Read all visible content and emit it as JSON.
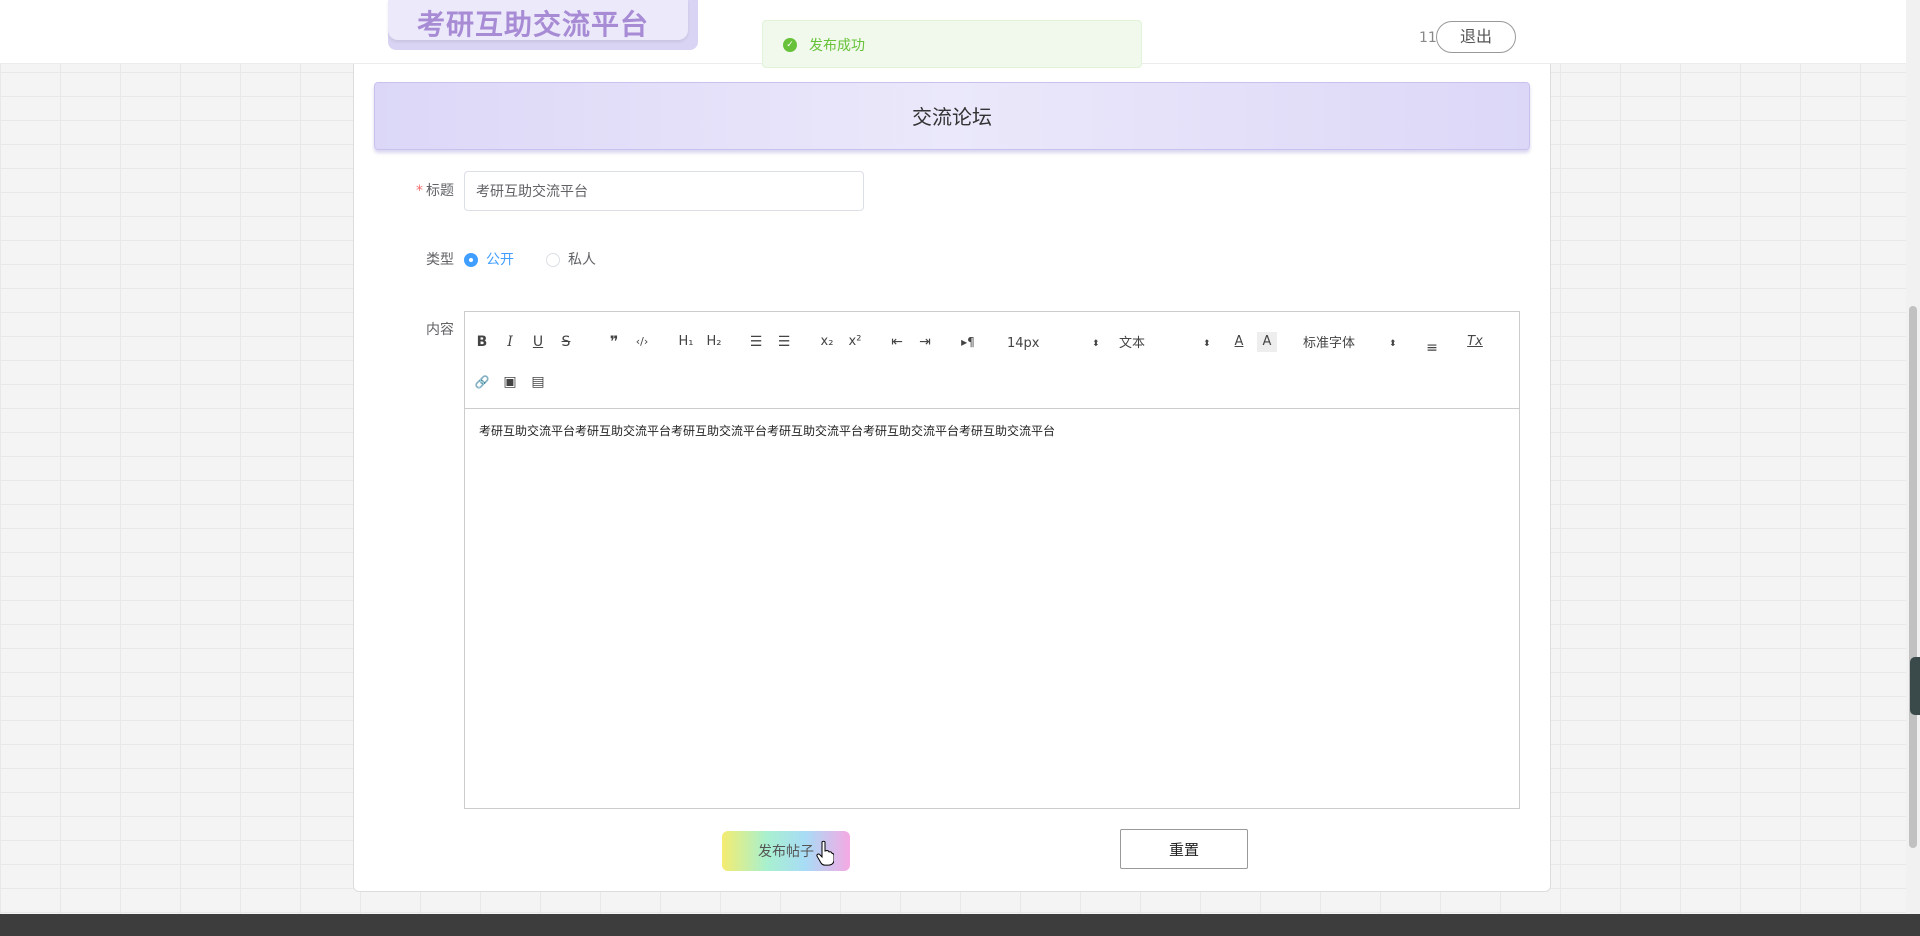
{
  "header": {
    "logo_text": "考研互助交流平台",
    "user_number": "11",
    "logout_label": "退出"
  },
  "toast": {
    "icon": "check-circle-icon",
    "message": "发布成功",
    "color": "#67c23a"
  },
  "forum": {
    "title": "交流论坛"
  },
  "form": {
    "title_label": "标题",
    "title_value": "考研互助交流平台",
    "type_label": "类型",
    "type_options": [
      {
        "label": "公开",
        "checked": true
      },
      {
        "label": "私人",
        "checked": false
      }
    ],
    "content_label": "内容",
    "content_text": "考研互助交流平台考研互助交流平台考研互助交流平台考研互助交流平台考研互助交流平台考研互助交流平台"
  },
  "toolbar": {
    "bold": "B",
    "italic": "I",
    "underline": "U",
    "strike": "S",
    "blockquote": "❞",
    "code": "‹/›",
    "h1": "H₁",
    "h2": "H₂",
    "ordered_list": "☰",
    "bullet_list": "☰",
    "subscript": "x₂",
    "superscript": "x²",
    "outdent": "⇤",
    "indent": "⇥",
    "direction": "▸¶",
    "font_size": "14px",
    "header_select": "文本",
    "font_color": "A",
    "bg_color": "A",
    "font_family": "标准字体",
    "align": "≡",
    "clean": "Tx",
    "link": "🔗",
    "image": "▣",
    "video": "▤"
  },
  "buttons": {
    "publish": "发布帖子",
    "reset": "重置"
  },
  "colors": {
    "accent": "#409eff",
    "logo": "#a78bd4",
    "header_bg": "#dcd7f7",
    "danger": "#f56c6c"
  }
}
